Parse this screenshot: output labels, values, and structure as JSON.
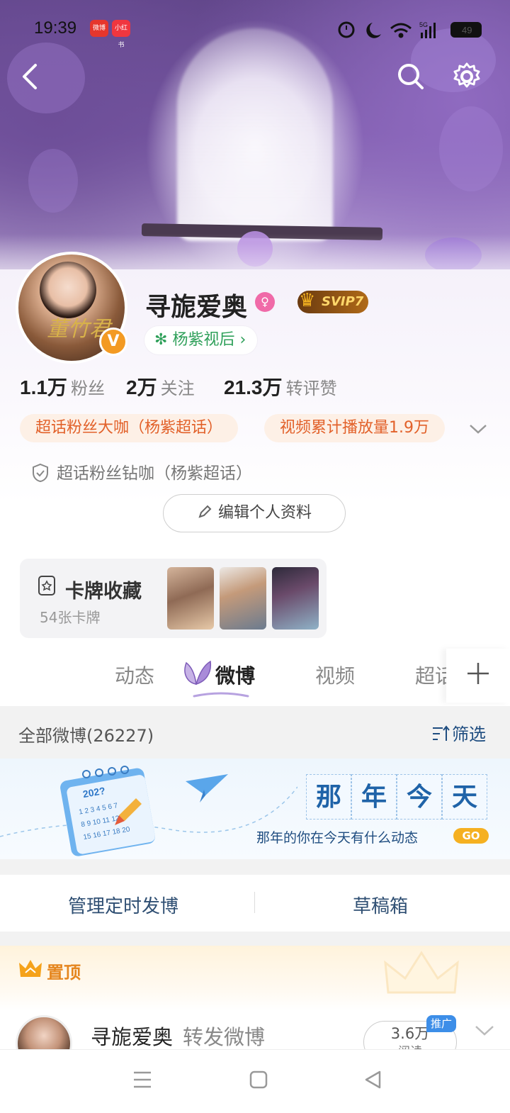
{
  "status_bar": {
    "time": "19:39",
    "apps": [
      "微博",
      "小红书"
    ],
    "network": "5G",
    "battery": "49"
  },
  "header": {
    "back_icon": "chevron-left-icon",
    "search_icon": "search-icon",
    "settings_icon": "gear-icon"
  },
  "profile": {
    "username": "寻旎爱奥",
    "avatar_text": "董竹君",
    "verified_badge": "V",
    "gender_icon": "female-icon",
    "vip_badge": "SVIP7",
    "super_topic": "杨紫视后",
    "stats": [
      {
        "value": "1.1万",
        "label": "粉丝"
      },
      {
        "value": "2万",
        "label": "关注"
      },
      {
        "value": "21.3万",
        "label": "转评赞"
      }
    ],
    "tags": [
      "超话粉丝大咖（杨紫超话）",
      "视频累计播放量1.9万"
    ],
    "diamond_tag": "超话粉丝钻咖（杨紫超话）",
    "edit_button": "编辑个人资料"
  },
  "card_collection": {
    "title": "卡牌收藏",
    "count": "54张卡牌"
  },
  "tabs": [
    "动态",
    "微博",
    "视频",
    "超话"
  ],
  "active_tab": "微博",
  "list_header": {
    "title": "全部微博(26227)",
    "filter": "筛选"
  },
  "memory_banner": {
    "calendar_year": "202?",
    "headline_chars": [
      "那",
      "年",
      "今",
      "天"
    ],
    "subtitle": "那年的你在今天有什么动态",
    "go_label": "GO"
  },
  "manage_bar": {
    "scheduled": "管理定时发博",
    "drafts": "草稿箱"
  },
  "pinned": {
    "label": "置顶"
  },
  "post": {
    "author": "寻旎爱奥",
    "action": "转发微博",
    "views": "3.6万",
    "views_label": "阅读",
    "promo_badge": "推广"
  },
  "colors": {
    "accent_orange": "#f39a23",
    "tag_text": "#e2612a",
    "super_topic_green": "#2fa05a",
    "link_blue": "#1f63a8"
  }
}
